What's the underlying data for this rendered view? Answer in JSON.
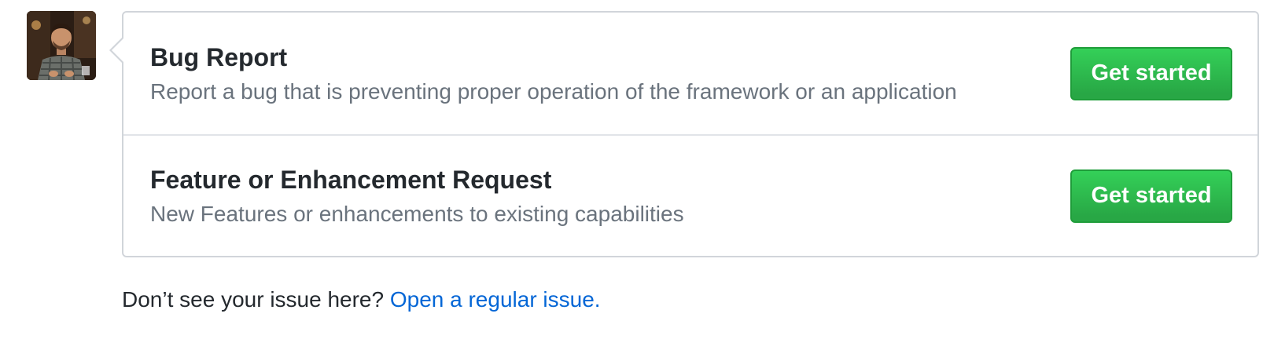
{
  "avatar": {
    "icon": "user-avatar"
  },
  "templates": [
    {
      "title": "Bug Report",
      "description": "Report a bug that is preventing proper operation of the framework or an application",
      "button_label": "Get started"
    },
    {
      "title": "Feature or Enhancement Request",
      "description": "New Features or enhancements to existing capabilities",
      "button_label": "Get started"
    }
  ],
  "footer": {
    "prompt": "Don’t see your issue here?",
    "link_label": "Open a regular issue."
  },
  "colors": {
    "button_green": "#2ea44f",
    "link_blue": "#0366d6",
    "description_gray": "#6a737d",
    "border_gray": "#d1d5da"
  }
}
